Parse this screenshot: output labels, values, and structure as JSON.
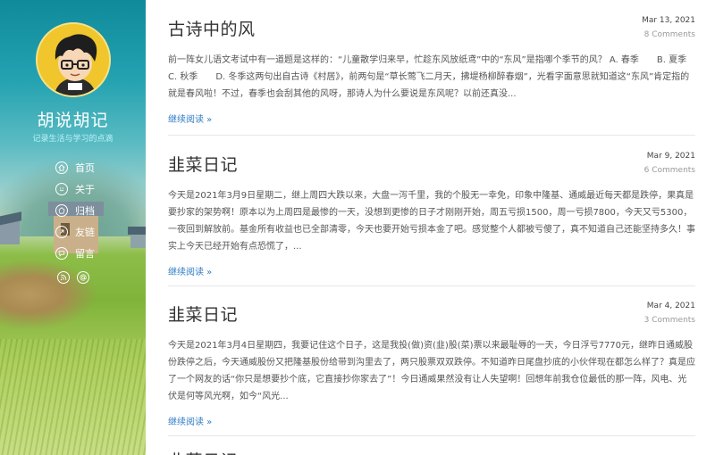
{
  "sidebar": {
    "title": "胡说胡记",
    "subtitle": "记录生活与学习的点滴",
    "nav": [
      {
        "label": "首页",
        "icon": "home-icon"
      },
      {
        "label": "关于",
        "icon": "smiley-icon"
      },
      {
        "label": "归档",
        "icon": "archive-icon"
      },
      {
        "label": "友链",
        "icon": "link-icon"
      },
      {
        "label": "留言",
        "icon": "comment-icon"
      }
    ],
    "social": [
      {
        "icon": "rss-icon"
      },
      {
        "icon": "at-icon"
      }
    ]
  },
  "posts": [
    {
      "title": "古诗中的风",
      "date": "Mar 13, 2021",
      "comments": "8 Comments",
      "excerpt": "前一阵女儿语文考试中有一道题是这样的：“儿童散学归来早，忙趁东风放纸鸢”中的“东风”是指哪个季节的风？ A. 春季　　B. 夏季　　C. 秋季　　D. 冬季这两句出自古诗《村居》，前两句是“草长莺飞二月天，拂堤杨柳醉春烟”，光看字面意思就知道这“东风”肯定指的就是春风啦！不过，春季也会刮其他的风呀，那诗人为什么要说是东风呢？以前还真没...",
      "read_more": "继续阅读 »"
    },
    {
      "title": "韭菜日记",
      "date": "Mar 9, 2021",
      "comments": "6 Comments",
      "excerpt": "今天是2021年3月9日星期二，继上周四大跌以来，大盘一泻千里，我的个股无一幸免，印象中隆基、通威最近每天都是跌停，果真是要抄家的架势啊！原本以为上周四是最惨的一天，没想到更惨的日子才刚刚开始，周五亏损1500，周一亏损7800，今天又亏5300，一夜回到解放前。基金所有收益也已全部清零，今天也要开始亏损本金了吧。感觉整个人都被亏傻了，真不知道自己还能坚持多久！事实上今天已经开始有点恐慌了，...",
      "read_more": "继续阅读 »"
    },
    {
      "title": "韭菜日记",
      "date": "Mar 4, 2021",
      "comments": "3 Comments",
      "excerpt": "今天是2021年3月4日星期四，我要记住这个日子，这是我投(做)资(韭)股(菜)票以来最耻辱的一天，今日浮亏7770元，继昨日通威股份跌停之后，今天通威股份又把隆基股份给带到沟里去了，两只股票双双跌停。不知道昨日尾盘抄底的小伙伴现在都怎么样了？真是应了一个网友的话“你只是想要抄个底，它直接抄你家去了”！今日通威果然没有让人失望啊！回想年前我仓位最低的那一阵，风电、光伏是何等风光啊，如今“风光...",
      "read_more": "继续阅读 »"
    }
  ],
  "next_post_title_partial": "韭菜日记"
}
